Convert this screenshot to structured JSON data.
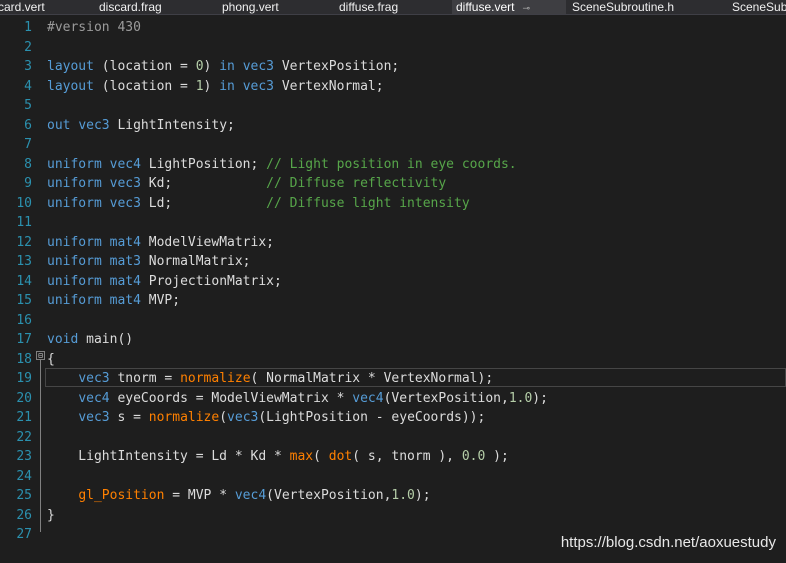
{
  "colors": {
    "background": "#1e1e1e",
    "keyword": "#569cd6",
    "comment": "#57a64a",
    "builtin": "#ff8000",
    "number": "#b5cea8",
    "text": "#dcdcdc",
    "line_number": "#2b91af",
    "preprocessor": "#9b9b9b"
  },
  "tabs": [
    {
      "label": "card.vert",
      "active": false
    },
    {
      "label": "discard.frag",
      "active": false
    },
    {
      "label": "phong.vert",
      "active": false
    },
    {
      "label": "diffuse.frag",
      "active": false
    },
    {
      "label": "diffuse.vert",
      "active": true,
      "pin_icon": "pin-icon"
    },
    {
      "label": "SceneSubroutine.h",
      "active": false
    },
    {
      "label": "SceneSub",
      "active": false
    }
  ],
  "editor": {
    "line_numbers": [
      "1",
      "2",
      "3",
      "4",
      "5",
      "6",
      "7",
      "8",
      "9",
      "10",
      "11",
      "12",
      "13",
      "14",
      "15",
      "16",
      "17",
      "18",
      "19",
      "20",
      "21",
      "22",
      "23",
      "24",
      "25",
      "26",
      "27"
    ],
    "lines": [
      [
        {
          "t": "#version 430",
          "c": "pp"
        }
      ],
      [],
      [
        {
          "t": "layout",
          "c": "kw"
        },
        {
          "t": " (location = ",
          "c": "tx"
        },
        {
          "t": "0",
          "c": "num"
        },
        {
          "t": ") ",
          "c": "tx"
        },
        {
          "t": "in",
          "c": "kw"
        },
        {
          "t": " ",
          "c": "tx"
        },
        {
          "t": "vec3",
          "c": "kw"
        },
        {
          "t": " VertexPosition;",
          "c": "tx"
        }
      ],
      [
        {
          "t": "layout",
          "c": "kw"
        },
        {
          "t": " (location = ",
          "c": "tx"
        },
        {
          "t": "1",
          "c": "num"
        },
        {
          "t": ") ",
          "c": "tx"
        },
        {
          "t": "in",
          "c": "kw"
        },
        {
          "t": " ",
          "c": "tx"
        },
        {
          "t": "vec3",
          "c": "kw"
        },
        {
          "t": " VertexNormal;",
          "c": "tx"
        }
      ],
      [],
      [
        {
          "t": "out",
          "c": "kw"
        },
        {
          "t": " ",
          "c": "tx"
        },
        {
          "t": "vec3",
          "c": "kw"
        },
        {
          "t": " LightIntensity;",
          "c": "tx"
        }
      ],
      [],
      [
        {
          "t": "uniform",
          "c": "kw"
        },
        {
          "t": " ",
          "c": "tx"
        },
        {
          "t": "vec4",
          "c": "kw"
        },
        {
          "t": " LightPosition; ",
          "c": "tx"
        },
        {
          "t": "// Light position in eye coords.",
          "c": "cm"
        }
      ],
      [
        {
          "t": "uniform",
          "c": "kw"
        },
        {
          "t": " ",
          "c": "tx"
        },
        {
          "t": "vec3",
          "c": "kw"
        },
        {
          "t": " Kd;            ",
          "c": "tx"
        },
        {
          "t": "// Diffuse reflectivity",
          "c": "cm"
        }
      ],
      [
        {
          "t": "uniform",
          "c": "kw"
        },
        {
          "t": " ",
          "c": "tx"
        },
        {
          "t": "vec3",
          "c": "kw"
        },
        {
          "t": " Ld;            ",
          "c": "tx"
        },
        {
          "t": "// Diffuse light intensity",
          "c": "cm"
        }
      ],
      [],
      [
        {
          "t": "uniform",
          "c": "kw"
        },
        {
          "t": " ",
          "c": "tx"
        },
        {
          "t": "mat4",
          "c": "kw"
        },
        {
          "t": " ModelViewMatrix;",
          "c": "tx"
        }
      ],
      [
        {
          "t": "uniform",
          "c": "kw"
        },
        {
          "t": " ",
          "c": "tx"
        },
        {
          "t": "mat3",
          "c": "kw"
        },
        {
          "t": " NormalMatrix;",
          "c": "tx"
        }
      ],
      [
        {
          "t": "uniform",
          "c": "kw"
        },
        {
          "t": " ",
          "c": "tx"
        },
        {
          "t": "mat4",
          "c": "kw"
        },
        {
          "t": " ProjectionMatrix;",
          "c": "tx"
        }
      ],
      [
        {
          "t": "uniform",
          "c": "kw"
        },
        {
          "t": " ",
          "c": "tx"
        },
        {
          "t": "mat4",
          "c": "kw"
        },
        {
          "t": " MVP;",
          "c": "tx"
        }
      ],
      [],
      [
        {
          "t": "void",
          "c": "kw"
        },
        {
          "t": " main()",
          "c": "tx"
        }
      ],
      [
        {
          "t": "{",
          "c": "tx"
        }
      ],
      [
        {
          "t": "    ",
          "c": "tx"
        },
        {
          "t": "vec3",
          "c": "kw"
        },
        {
          "t": " tnorm = ",
          "c": "tx"
        },
        {
          "t": "normalize",
          "c": "bi"
        },
        {
          "t": "( NormalMatrix * VertexNormal);",
          "c": "tx"
        }
      ],
      [
        {
          "t": "    ",
          "c": "tx"
        },
        {
          "t": "vec4",
          "c": "kw"
        },
        {
          "t": " eyeCoords = ModelViewMatrix * ",
          "c": "tx"
        },
        {
          "t": "vec4",
          "c": "kw"
        },
        {
          "t": "(VertexPosition,",
          "c": "tx"
        },
        {
          "t": "1.0",
          "c": "num"
        },
        {
          "t": ");",
          "c": "tx"
        }
      ],
      [
        {
          "t": "    ",
          "c": "tx"
        },
        {
          "t": "vec3",
          "c": "kw"
        },
        {
          "t": " s = ",
          "c": "tx"
        },
        {
          "t": "normalize",
          "c": "bi"
        },
        {
          "t": "(",
          "c": "tx"
        },
        {
          "t": "vec3",
          "c": "kw"
        },
        {
          "t": "(LightPosition - eyeCoords));",
          "c": "tx"
        }
      ],
      [],
      [
        {
          "t": "    LightIntensity = Ld * Kd * ",
          "c": "tx"
        },
        {
          "t": "max",
          "c": "bi"
        },
        {
          "t": "( ",
          "c": "tx"
        },
        {
          "t": "dot",
          "c": "bi"
        },
        {
          "t": "( s, tnorm ), ",
          "c": "tx"
        },
        {
          "t": "0.0",
          "c": "num"
        },
        {
          "t": " );",
          "c": "tx"
        }
      ],
      [],
      [
        {
          "t": "    ",
          "c": "tx"
        },
        {
          "t": "gl_Position",
          "c": "bi"
        },
        {
          "t": " = MVP * ",
          "c": "tx"
        },
        {
          "t": "vec4",
          "c": "kw"
        },
        {
          "t": "(VertexPosition,",
          "c": "tx"
        },
        {
          "t": "1.0",
          "c": "num"
        },
        {
          "t": ");",
          "c": "tx"
        }
      ],
      [
        {
          "t": "}",
          "c": "tx"
        }
      ],
      []
    ],
    "fold_icon": "collapse-icon",
    "fold_glyph": "⊟"
  },
  "watermark": "https://blog.csdn.net/aoxuestudy"
}
